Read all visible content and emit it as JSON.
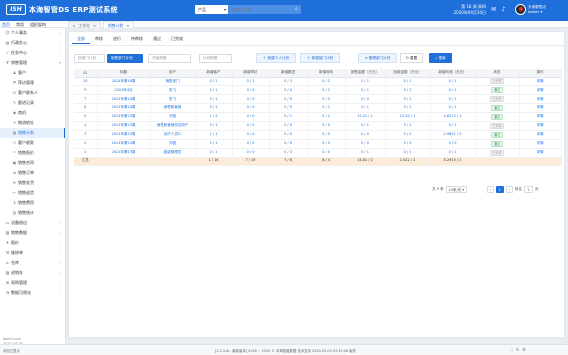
{
  "app": {
    "logo": "ISH",
    "title": "本海智管DS ERP测试系统"
  },
  "search": {
    "type_label": "产品",
    "placeholder": "请输入名称",
    "icon": "search-icon"
  },
  "top_info": {
    "week": "第 18 周 周四",
    "date": "2020年04月30日"
  },
  "user": {
    "name": "天地零售店",
    "account": "Admin"
  },
  "nav_tabs": [
    "首页",
    "常用",
    "组织架构"
  ],
  "page_tabs": [
    {
      "label": "工作台",
      "close": "×"
    },
    {
      "label": "销售计划",
      "close": "×"
    }
  ],
  "sidebar": {
    "items": [
      {
        "label": "个人事务",
        "icon": "user-icon",
        "type": "group"
      },
      {
        "label": "行政办公",
        "icon": "office-icon",
        "type": "group"
      },
      {
        "label": "任务中心",
        "icon": "task-icon",
        "type": "group"
      },
      {
        "label": "销售管理",
        "icon": "sales-icon",
        "type": "group-open"
      },
      {
        "label": "客户",
        "icon": "customer-icon",
        "type": "sub"
      },
      {
        "label": "拜访管理",
        "icon": "visit-icon",
        "type": "sub"
      },
      {
        "label": "客户联系人",
        "icon": "contact-icon",
        "type": "sub"
      },
      {
        "label": "跟进记录",
        "icon": "followup-icon",
        "type": "sub"
      },
      {
        "label": "商机",
        "icon": "opportunity-icon",
        "type": "sub"
      },
      {
        "label": "物流地址",
        "icon": "address-icon",
        "type": "sub"
      },
      {
        "label": "销售计划",
        "icon": "plan-icon",
        "type": "sub-active"
      },
      {
        "label": "客户收款",
        "icon": "payment-icon",
        "type": "sub"
      },
      {
        "label": "销售报价",
        "icon": "quote-icon",
        "type": "sub"
      },
      {
        "label": "销售合同",
        "icon": "contract-icon",
        "type": "sub"
      },
      {
        "label": "销售订单",
        "icon": "order-icon",
        "type": "sub"
      },
      {
        "label": "销售发货",
        "icon": "delivery-icon",
        "type": "sub"
      },
      {
        "label": "销售退货",
        "icon": "return-icon",
        "type": "sub"
      },
      {
        "label": "销售费用",
        "icon": "expense-icon",
        "type": "sub"
      },
      {
        "label": "销售统计",
        "icon": "stats-icon",
        "type": "sub"
      },
      {
        "label": "设备借出",
        "icon": "device-icon",
        "type": "group"
      },
      {
        "label": "销售数据",
        "icon": "data-icon",
        "type": "group"
      },
      {
        "label": "报价",
        "icon": "price-icon",
        "type": "group"
      },
      {
        "label": "维修单",
        "icon": "repair-icon",
        "type": "group"
      },
      {
        "label": "仓库",
        "icon": "warehouse-icon",
        "type": "group"
      },
      {
        "label": "进销存",
        "icon": "stock-icon",
        "type": "group"
      },
      {
        "label": "采购管理",
        "icon": "purchase-icon",
        "type": "group"
      },
      {
        "label": "数据可视化",
        "icon": "chart-icon",
        "type": "group"
      }
    ],
    "footer_line1": "benhi.com",
    "footer_line2": "2020-04-28"
  },
  "status_tabs": [
    "全部",
    "审核",
    "进行",
    "待审核",
    "通过",
    "已完成"
  ],
  "filters": {
    "plan_select": "按部门计划",
    "dept_select": "销售部门计划",
    "period_select": "开始周期",
    "end_select": "计划周期",
    "btn_new_person": "新建个人计划",
    "btn_new_dept": "新建部门计划",
    "btn_manage_dept": "管理部门计划",
    "btn_reset": "重置",
    "btn_search": "搜索"
  },
  "table": {
    "columns": [
      "ID",
      "标题",
      "用户",
      "新增客户",
      "新增拜访",
      "新增跟进",
      "新增商机",
      "销售金额（万元）",
      "回款金额（万元）",
      "新增利润（万元）",
      "状态",
      "操作"
    ],
    "rows": [
      {
        "id": "10",
        "title": "2024年第18周",
        "user": "销售部门",
        "c1": "0 / 1",
        "c2": "0 / 2",
        "c3": "0 / 3",
        "c4": "0 / 2",
        "sales": "0 / 1",
        "collect": "0 / 1",
        "profit": "0 / 1",
        "status": "已完成",
        "status_type": "done",
        "action": "详情"
      },
      {
        "id": "9",
        "title": "2024年4月",
        "user": "张飞",
        "c1": "0 / 1",
        "c2": "0 / 0",
        "c3": "0 / 0",
        "c4": "0 / 1",
        "sales": "0 / 1",
        "collect": "0 / 1",
        "profit": "0 / 1",
        "status": "通过",
        "status_type": "ok",
        "action": "详情"
      },
      {
        "id": "7",
        "title": "2024年第16周",
        "user": "张飞",
        "c1": "0 / 1",
        "c2": "0 / 0",
        "c3": "0 / 0",
        "c4": "0 / 0",
        "sales": "0 / 0",
        "collect": "0 / 1",
        "profit": "0 / 1",
        "status": "已完成",
        "status_type": "done",
        "action": "详情"
      },
      {
        "id": "6",
        "title": "2024年第16周",
        "user": "销售和营销",
        "c1": "0 / 1",
        "c2": "0 / 0",
        "c3": "0 / 0",
        "c4": "0 / 1",
        "sales": "0 / 1",
        "collect": "0 / 1",
        "profit": "0 / 1",
        "status": "通过",
        "status_type": "ok",
        "action": "详情"
      },
      {
        "id": "5",
        "title": "2024年第15周",
        "user": "刘强",
        "c1": "1 / 5",
        "c2": "0 / 0",
        "c3": "0 / 1",
        "c4": "0 / 1",
        "sales": "15.41 / 1",
        "collect": "13.45 / 1",
        "profit": "4.8275 / 1",
        "status": "通过",
        "status_type": "ok",
        "action": "详情"
      },
      {
        "id": "4",
        "title": "2024年第15周",
        "user": "销售和营销测试用户",
        "c1": "0 / 1",
        "c2": "0 / 0",
        "c3": "0 / 0",
        "c4": "0 / 0",
        "sales": "0 / 1",
        "collect": "0 / 1",
        "profit": "0 / 1",
        "status": "已完成",
        "status_type": "done",
        "action": "详情"
      },
      {
        "id": "3",
        "title": "2024年第15周",
        "user": "用户人员D",
        "c1": "1 / 1",
        "c2": "0 / 0",
        "c3": "0 / 0",
        "c4": "0 / 0",
        "sales": "0 / 0",
        "collect": "0 / 0",
        "profit": "0.9651 / 0",
        "status": "通过",
        "status_type": "ok",
        "action": "详情"
      },
      {
        "id": "2",
        "title": "2024年第14周",
        "user": "刘强",
        "c1": "0 / 1",
        "c2": "0 / 0",
        "c3": "0 / 0",
        "c4": "0 / 0",
        "sales": "0 / 0",
        "collect": "0 / 0",
        "profit": "0 / 0",
        "status": "通过",
        "status_type": "ok",
        "action": "详情"
      },
      {
        "id": "1",
        "title": "2024年第13周",
        "user": "超级管理员",
        "c1": "0 / 1",
        "c2": "0 / 0",
        "c3": "0 / 3",
        "c4": "0 / 0",
        "sales": "0 / 1",
        "collect": "0 / 1",
        "profit": "0 / 1",
        "status": "已完成",
        "status_type": "done",
        "action": "详情"
      }
    ],
    "total": {
      "label": "汇总",
      "c1": "1 / 16",
      "c2": "7 / 19",
      "c3": "7 / 8",
      "c4": "8 / 4",
      "sales": "14.81 / 2",
      "collect": "2.022 / 2",
      "profit": "5.2915 / 2"
    }
  },
  "pager": {
    "total_text": "共 9 条",
    "page_size": "10条/页",
    "prev": "‹",
    "current": "1",
    "next": "›",
    "goto_label": "前往",
    "goto_value": "1",
    "page_unit": "页"
  },
  "bottombar": {
    "left_text": "状态已显示",
    "center_text": "[2.0.3.dc, 最新版本]  2018 ~ 2020 © 本海智管数据 技术支持  2020-05-04 03:33:58 版权",
    "colors": {
      "accent": "#1e6fd9",
      "ok": "#2e9e4b",
      "total_bg": "#fcecd7"
    }
  }
}
